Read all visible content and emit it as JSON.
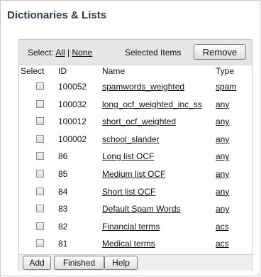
{
  "panel": {
    "title": "Dictionaries & Lists"
  },
  "select_bar": {
    "prefix": "Select:",
    "all": "All",
    "separator": "|",
    "none": "None",
    "selected_items": "Selected Items",
    "remove": "Remove"
  },
  "table": {
    "headers": {
      "select": "Select",
      "id": "ID",
      "name": "Name",
      "type": "Type"
    },
    "rows": [
      {
        "id": "100052",
        "name": "spamwords_weighted",
        "type": "spam"
      },
      {
        "id": "100032",
        "name": "long_ocf_weighted_inc_ss",
        "type": "any"
      },
      {
        "id": "100012",
        "name": "short_ocf_weighted",
        "type": "any"
      },
      {
        "id": "100002",
        "name": "school_slander",
        "type": "any"
      },
      {
        "id": "86",
        "name": "Long list OCF",
        "type": "any"
      },
      {
        "id": "85",
        "name": "Medium list OCF",
        "type": "any"
      },
      {
        "id": "84",
        "name": "Short list OCF",
        "type": "any"
      },
      {
        "id": "83",
        "name": "Default Spam Words",
        "type": "any"
      },
      {
        "id": "82",
        "name": "Financial terms",
        "type": "acs"
      },
      {
        "id": "81",
        "name": "Medical terms",
        "type": "acs"
      }
    ]
  },
  "footer": {
    "add": "Add",
    "finished": "Finished",
    "help": "Help"
  }
}
